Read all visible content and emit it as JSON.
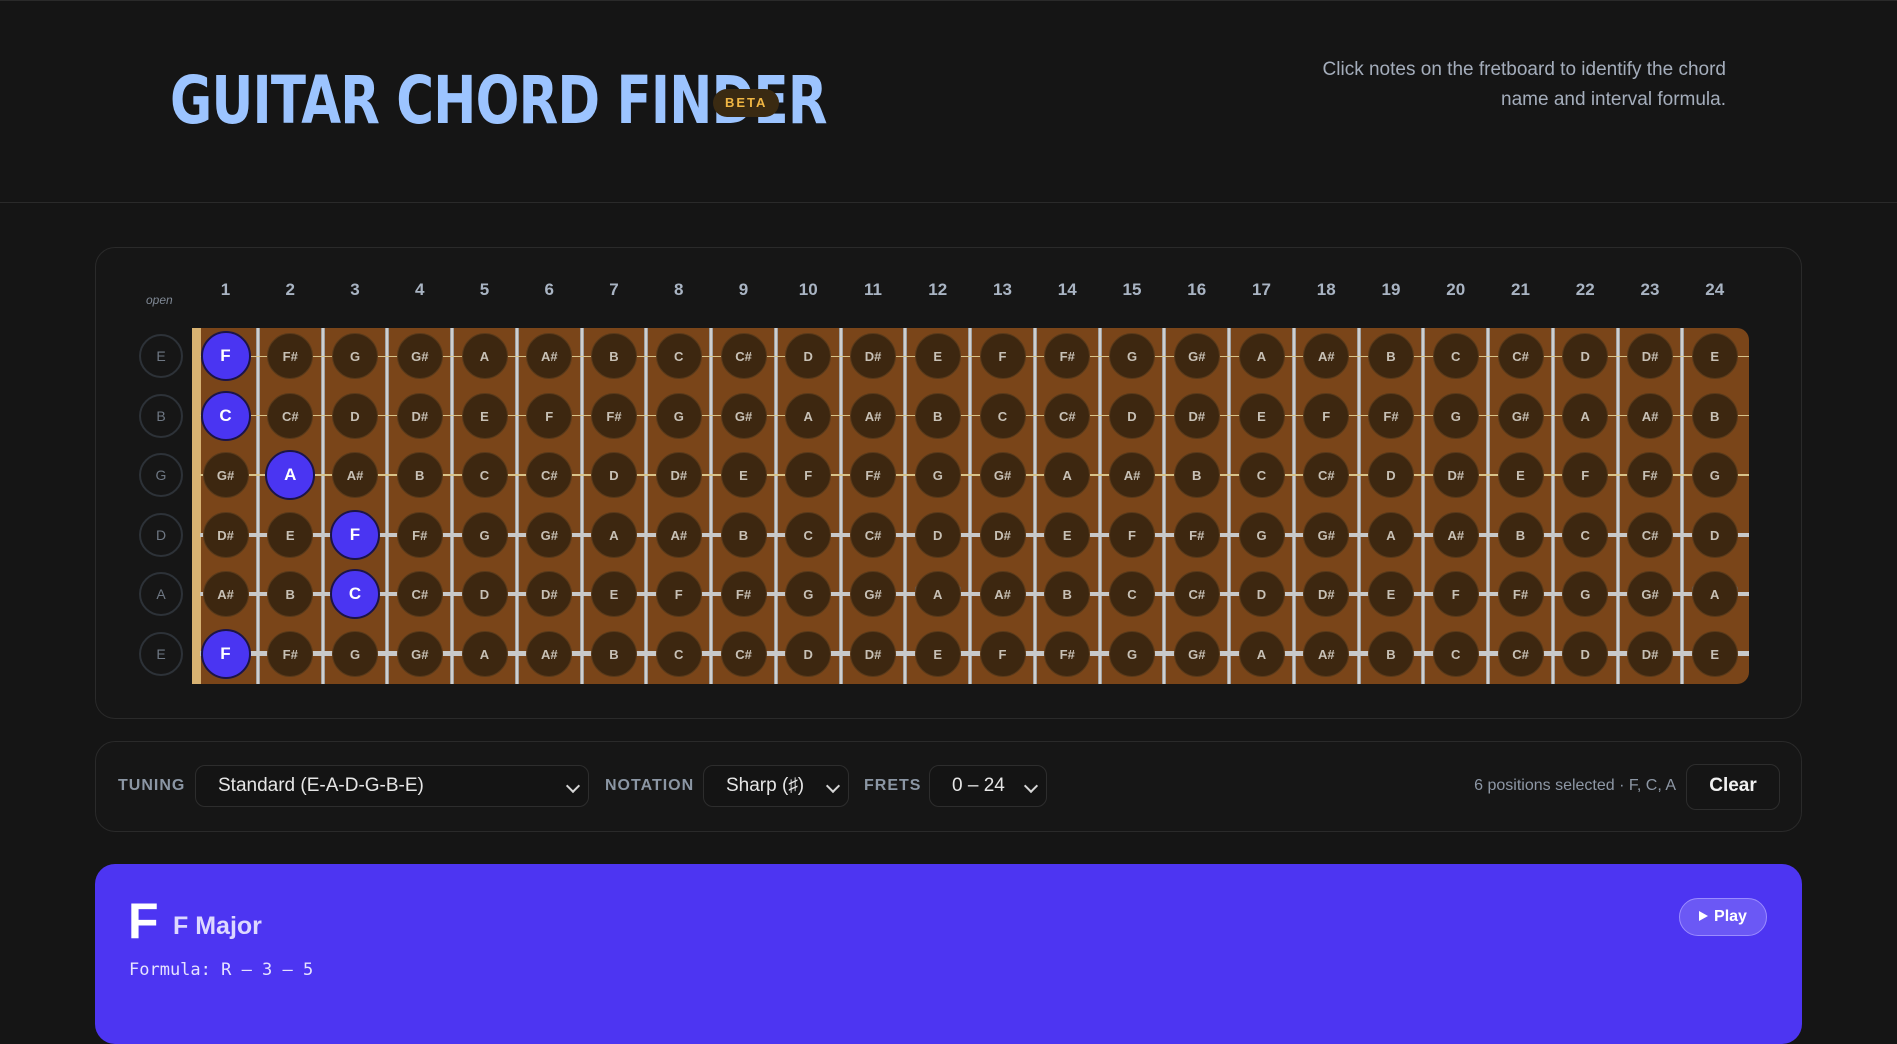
{
  "header": {
    "title": "GUITAR CHORD FINDER",
    "badge": "BETA",
    "subtitle": "Click notes on the fretboard to identify the chord name and interval formula."
  },
  "fretboard": {
    "open_label": "open",
    "fret_numbers": [
      "1",
      "2",
      "3",
      "4",
      "5",
      "6",
      "7",
      "8",
      "9",
      "10",
      "11",
      "12",
      "13",
      "14",
      "15",
      "16",
      "17",
      "18",
      "19",
      "20",
      "21",
      "22",
      "23",
      "24"
    ],
    "open_strings": [
      "E",
      "B",
      "G",
      "D",
      "A",
      "E"
    ],
    "rows": [
      [
        "F",
        "F#",
        "G",
        "G#",
        "A",
        "A#",
        "B",
        "C",
        "C#",
        "D",
        "D#",
        "E",
        "F",
        "F#",
        "G",
        "G#",
        "A",
        "A#",
        "B",
        "C",
        "C#",
        "D",
        "D#",
        "E"
      ],
      [
        "C",
        "C#",
        "D",
        "D#",
        "E",
        "F",
        "F#",
        "G",
        "G#",
        "A",
        "A#",
        "B",
        "C",
        "C#",
        "D",
        "D#",
        "E",
        "F",
        "F#",
        "G",
        "G#",
        "A",
        "A#",
        "B"
      ],
      [
        "G#",
        "A",
        "A#",
        "B",
        "C",
        "C#",
        "D",
        "D#",
        "E",
        "F",
        "F#",
        "G",
        "G#",
        "A",
        "A#",
        "B",
        "C",
        "C#",
        "D",
        "D#",
        "E",
        "F",
        "F#",
        "G"
      ],
      [
        "D#",
        "E",
        "F",
        "F#",
        "G",
        "G#",
        "A",
        "A#",
        "B",
        "C",
        "C#",
        "D",
        "D#",
        "E",
        "F",
        "F#",
        "G",
        "G#",
        "A",
        "A#",
        "B",
        "C",
        "C#",
        "D"
      ],
      [
        "A#",
        "B",
        "C",
        "C#",
        "D",
        "D#",
        "E",
        "F",
        "F#",
        "G",
        "G#",
        "A",
        "A#",
        "B",
        "C",
        "C#",
        "D",
        "D#",
        "E",
        "F",
        "F#",
        "G",
        "G#",
        "A"
      ],
      [
        "F",
        "F#",
        "G",
        "G#",
        "A",
        "A#",
        "B",
        "C",
        "C#",
        "D",
        "D#",
        "E",
        "F",
        "F#",
        "G",
        "G#",
        "A",
        "A#",
        "B",
        "C",
        "C#",
        "D",
        "D#",
        "E"
      ]
    ],
    "selected": [
      [
        0,
        1
      ],
      [
        1,
        1
      ],
      [
        2,
        2
      ],
      [
        3,
        3
      ],
      [
        4,
        3
      ],
      [
        5,
        1
      ]
    ],
    "colors": {
      "board": "#7a4519",
      "selected": "#4a35f2",
      "note": "#3d2710"
    }
  },
  "controls": {
    "tuning_label": "TUNING",
    "tuning_value": "Standard (E-A-D-G-B-E)",
    "notation_label": "NOTATION",
    "notation_value": "Sharp (♯)",
    "frets_label": "FRETS",
    "frets_value": "0 – 24",
    "status": "6 positions selected · F, C, A",
    "clear_label": "Clear"
  },
  "result": {
    "root": "F",
    "name": "F Major",
    "formula": "Formula: R – 3 – 5",
    "play_label": "Play",
    "color": "#4d35f2"
  }
}
